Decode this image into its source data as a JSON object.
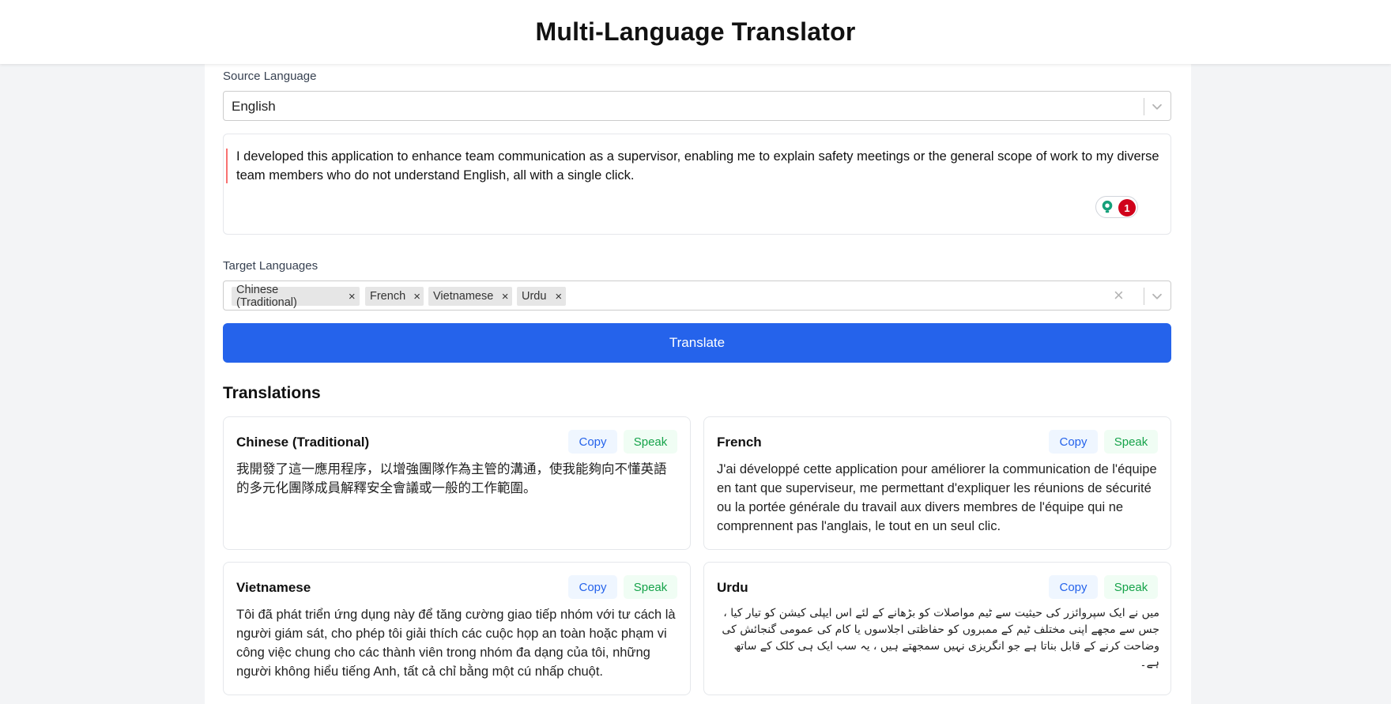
{
  "header": {
    "title": "Multi-Language Translator"
  },
  "source": {
    "label": "Source Language",
    "selected": "English"
  },
  "input": {
    "text": "I developed this application to enhance team communication as a supervisor, enabling me to explain safety meetings or the general scope of work to my diverse team members who do not understand English, all with a single click.",
    "grammar_issue_count": "1"
  },
  "targets": {
    "label": "Target Languages",
    "chips": [
      "Chinese (Traditional)",
      "French",
      "Vietnamese",
      "Urdu"
    ],
    "remove_glyph": "×",
    "clear_glyph": "×"
  },
  "translate_button": "Translate",
  "translations": {
    "title": "Translations",
    "copy_label": "Copy",
    "speak_label": "Speak",
    "items": [
      {
        "language": "Chinese (Traditional)",
        "text": "我開發了這一應用程序，以增強團隊作為主管的溝通，使我能夠向不懂英語的多元化團隊成員解釋安全會議或一般的工作範圍。"
      },
      {
        "language": "French",
        "text": "J'ai développé cette application pour améliorer la communication de l'équipe en tant que superviseur, me permettant d'expliquer les réunions de sécurité ou la portée générale du travail aux divers membres de l'équipe qui ne comprennent pas l'anglais, le tout en un seul clic."
      },
      {
        "language": "Vietnamese",
        "text": "Tôi đã phát triển ứng dụng này để tăng cường giao tiếp nhóm với tư cách là người giám sát, cho phép tôi giải thích các cuộc họp an toàn hoặc phạm vi công việc chung cho các thành viên trong nhóm đa dạng của tôi, những người không hiểu tiếng Anh, tất cả chỉ bằng một cú nhấp chuột."
      },
      {
        "language": "Urdu",
        "text": "میں نے ایک سپروائزر کی حیثیت سے ٹیم مواصلات کو بڑھانے کے لئے اس ایپلی کیشن کو تیار کیا ، جس سے مجھے اپنی مختلف ٹیم کے ممبروں کو حفاظتی اجلاسوں یا کام کی عمومی گنجائش کی وضاحت کرنے کے قابل بناتا ہے جو انگریزی نہیں سمجھتے ہیں ، یہ سب ایک ہی کلک کے ساتھ ہے۔"
      }
    ]
  },
  "colors": {
    "accent": "#2563eb",
    "copy_bg": "#eff6ff",
    "speak_bg": "#f0fdf4",
    "speak_text": "#16a34a",
    "grammar_badge": "#d0021b"
  }
}
